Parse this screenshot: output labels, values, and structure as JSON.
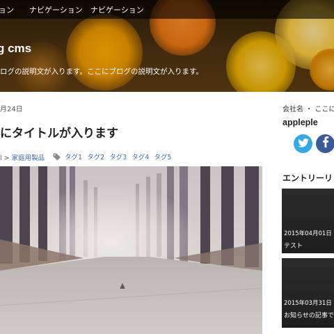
{
  "nav": {
    "items": [
      {
        "label": "ョン"
      },
      {
        "label": "ナビゲーション"
      },
      {
        "label": "ナビゲーション"
      }
    ]
  },
  "site": {
    "title": "g cms",
    "description": "ログの説明文が入ります。ここにブログの説明文が入ります。"
  },
  "post": {
    "date": "月24日",
    "title": "にタイトルが入ります",
    "breadcrumb": {
      "prefix": "l",
      "separator": ">",
      "category": "家庭用製品"
    },
    "tags": [
      "タグ1",
      "タグ2",
      "タグ3",
      "タグ4",
      "タグ5"
    ]
  },
  "sidebar": {
    "company": "会社名 ・ ここに",
    "author": "appleple",
    "entries_heading": "エントリーリ",
    "entries": [
      {
        "date": "2015年04月01日",
        "title": "テスト"
      },
      {
        "date": "2015年03月31日",
        "title": "お知らせの記事で"
      }
    ]
  },
  "colors": {
    "link": "#3a6fb0",
    "twitter": "#35a9e6",
    "facebook": "#3a5a9c",
    "nav_bar": "#000000"
  },
  "icons": {
    "tag": "tag-icon",
    "twitter": "twitter-icon",
    "facebook": "facebook-icon"
  }
}
